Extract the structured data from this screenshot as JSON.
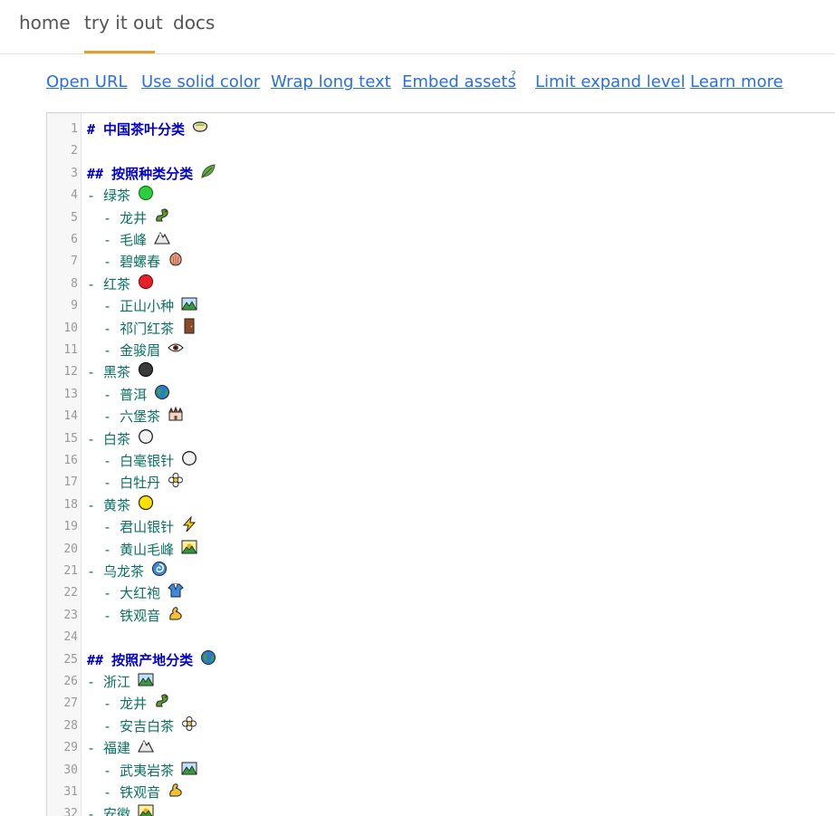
{
  "nav": {
    "tabs": [
      "home",
      "try it out",
      "docs"
    ],
    "active": 1
  },
  "toolbar": {
    "open_url": "Open URL",
    "solid_color": "Use solid color",
    "wrap_text": "Wrap long text",
    "embed_assets": "Embed assets",
    "embed_help": "?",
    "limit_expand": "Limit expand level",
    "learn_more": "Learn more"
  },
  "editor": {
    "lines": [
      {
        "n": "1",
        "text": "# 中国茶叶分类",
        "kind": "h",
        "icon": "tea-cup-icon"
      },
      {
        "n": "2",
        "text": "",
        "kind": "blank",
        "icon": ""
      },
      {
        "n": "3",
        "text": "## 按照种类分类",
        "kind": "h",
        "icon": "leaf-icon"
      },
      {
        "n": "4",
        "text": "- 绿茶",
        "kind": "li1",
        "icon": "green-circle-icon"
      },
      {
        "n": "5",
        "text": "  - 龙井",
        "kind": "li2",
        "icon": "dragon-icon"
      },
      {
        "n": "6",
        "text": "  - 毛峰",
        "kind": "li2",
        "icon": "mountain-icon"
      },
      {
        "n": "7",
        "text": "  - 碧螺春",
        "kind": "li2",
        "icon": "shell-icon"
      },
      {
        "n": "8",
        "text": "- 红茶",
        "kind": "li1",
        "icon": "red-circle-icon"
      },
      {
        "n": "9",
        "text": "  - 正山小种",
        "kind": "li2",
        "icon": "landscape-icon"
      },
      {
        "n": "10",
        "text": "  - 祁门红茶",
        "kind": "li2",
        "icon": "door-icon"
      },
      {
        "n": "11",
        "text": "  - 金骏眉",
        "kind": "li2",
        "icon": "eye-icon"
      },
      {
        "n": "12",
        "text": "- 黑茶",
        "kind": "li1",
        "icon": "black-circle-icon"
      },
      {
        "n": "13",
        "text": "  - 普洱",
        "kind": "li2",
        "icon": "globe-icon"
      },
      {
        "n": "14",
        "text": "  - 六堡茶",
        "kind": "li2",
        "icon": "castle-icon"
      },
      {
        "n": "15",
        "text": "- 白茶",
        "kind": "li1",
        "icon": "white-circle-icon"
      },
      {
        "n": "16",
        "text": "  - 白毫银针",
        "kind": "li2",
        "icon": "white-circle-icon"
      },
      {
        "n": "17",
        "text": "  - 白牡丹",
        "kind": "li2",
        "icon": "flower-icon"
      },
      {
        "n": "18",
        "text": "- 黄茶",
        "kind": "li1",
        "icon": "yellow-circle-icon"
      },
      {
        "n": "19",
        "text": "  - 君山银针",
        "kind": "li2",
        "icon": "lightning-icon"
      },
      {
        "n": "20",
        "text": "  - 黄山毛峰",
        "kind": "li2",
        "icon": "sunrise-mountain-icon"
      },
      {
        "n": "21",
        "text": "- 乌龙茶",
        "kind": "li1",
        "icon": "cyclone-icon"
      },
      {
        "n": "22",
        "text": "  - 大红袍",
        "kind": "li2",
        "icon": "robe-icon"
      },
      {
        "n": "23",
        "text": "  - 铁观音",
        "kind": "li2",
        "icon": "muscle-icon"
      },
      {
        "n": "24",
        "text": "",
        "kind": "blank",
        "icon": ""
      },
      {
        "n": "25",
        "text": "## 按照产地分类",
        "kind": "h",
        "icon": "globe-icon"
      },
      {
        "n": "26",
        "text": "- 浙江",
        "kind": "li1",
        "icon": "landscape-icon"
      },
      {
        "n": "27",
        "text": "  - 龙井",
        "kind": "li2",
        "icon": "dragon-icon"
      },
      {
        "n": "28",
        "text": "  - 安吉白茶",
        "kind": "li2",
        "icon": "flower-icon"
      },
      {
        "n": "29",
        "text": "- 福建",
        "kind": "li1",
        "icon": "mountain-icon"
      },
      {
        "n": "30",
        "text": "  - 武夷岩茶",
        "kind": "li2",
        "icon": "landscape-icon"
      },
      {
        "n": "31",
        "text": "  - 铁观音",
        "kind": "li2",
        "icon": "muscle-icon"
      },
      {
        "n": "32",
        "text": "- 安徽",
        "kind": "li1",
        "icon": "sunrise-mountain-icon"
      }
    ]
  },
  "colors": {
    "link": "#2a6fdb",
    "accent": "#e0a030",
    "heading": "#0000cc",
    "list": "#0b7261"
  }
}
